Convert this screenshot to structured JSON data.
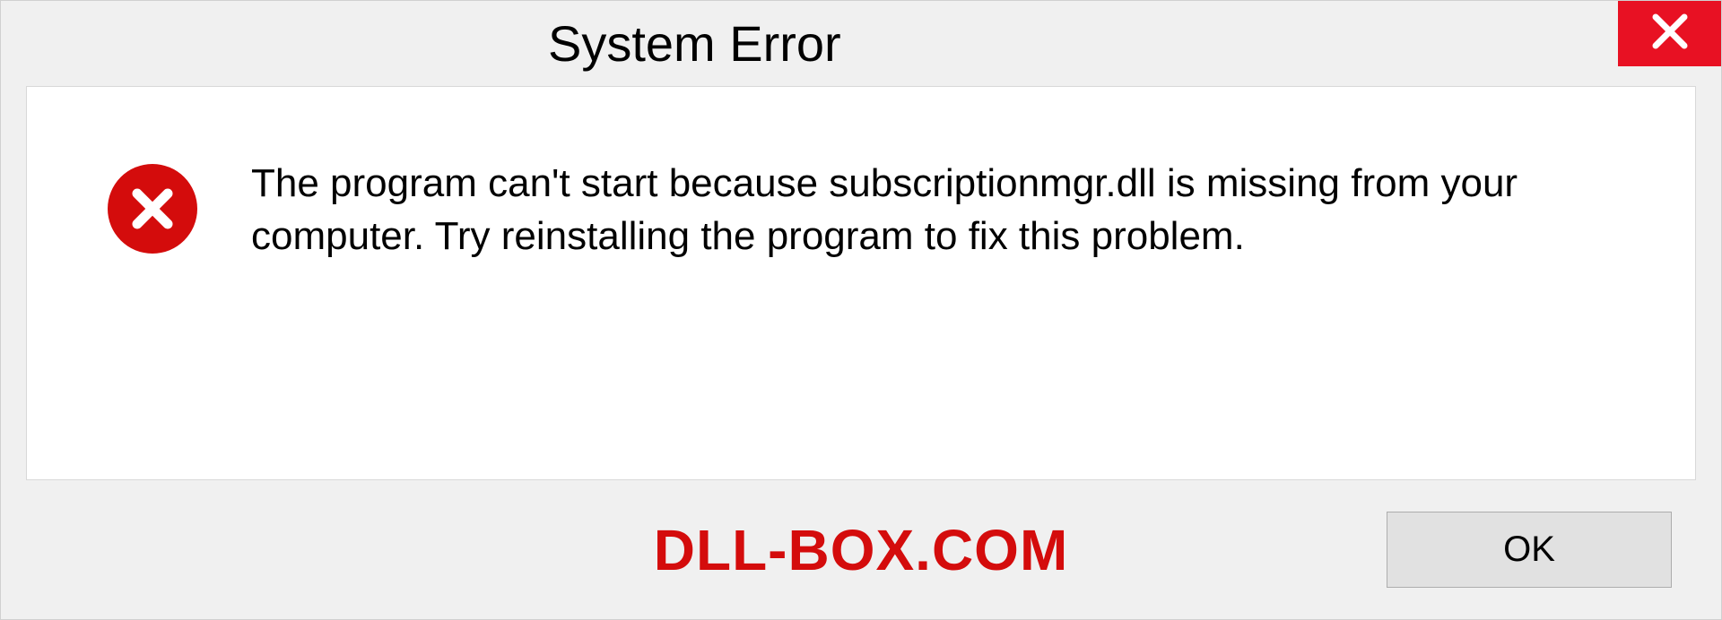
{
  "dialog": {
    "title": "System Error",
    "message": "The program can't start because subscriptionmgr.dll is missing from your computer. Try reinstalling the program to fix this problem.",
    "ok_label": "OK"
  },
  "watermark": "DLL-BOX.COM"
}
